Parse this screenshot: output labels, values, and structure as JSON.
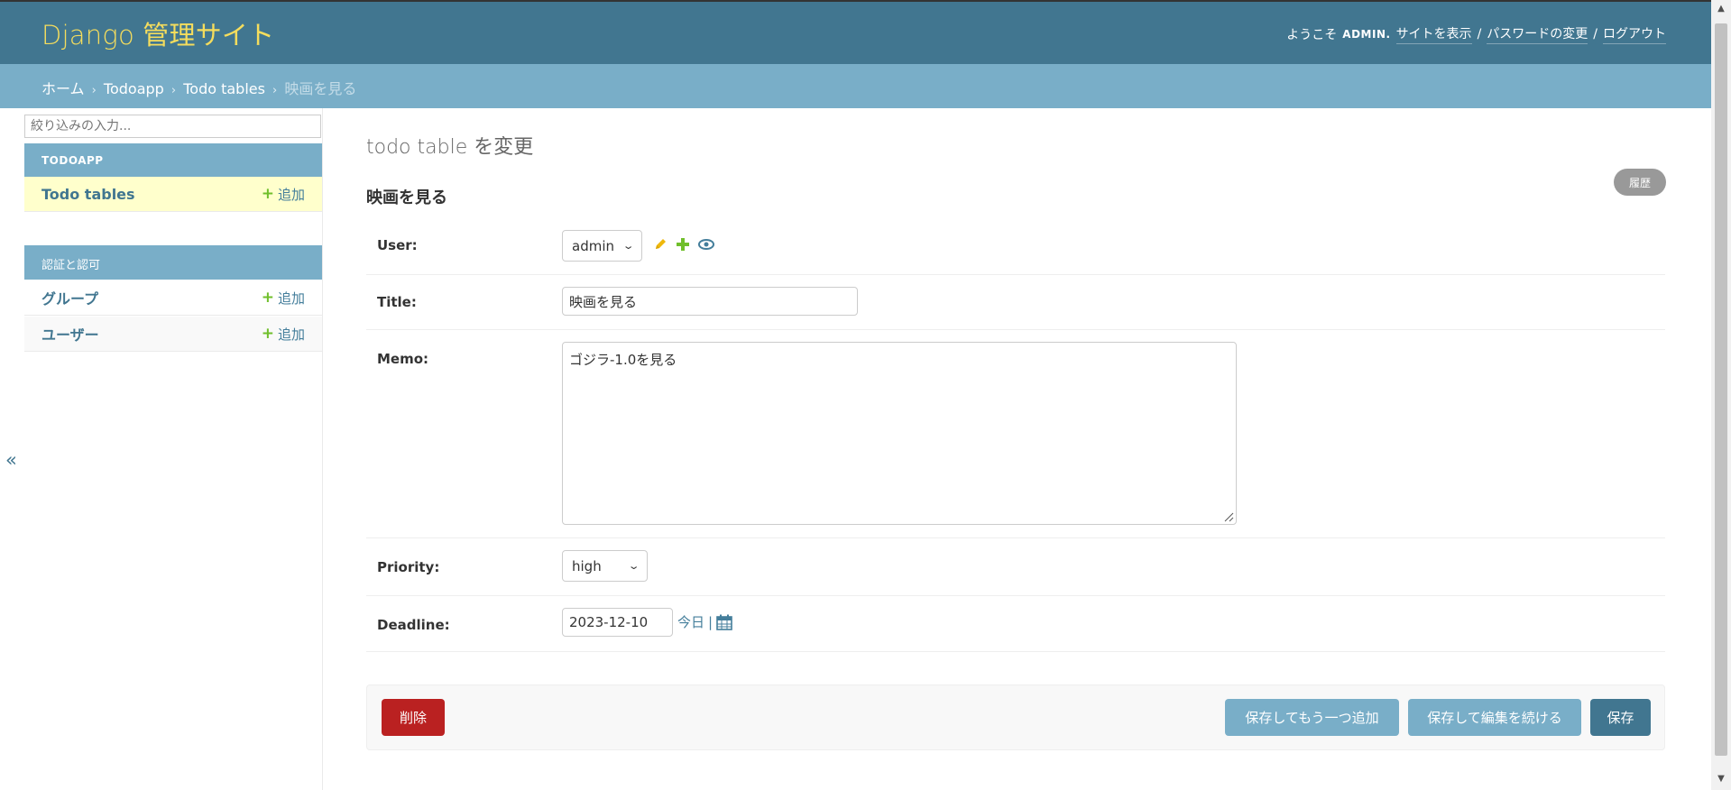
{
  "header": {
    "site_name": "Django 管理サイト",
    "welcome": "ようこそ",
    "username": "ADMIN",
    "welcome_suffix": ".",
    "view_site": "サイトを表示",
    "change_password": "パスワードの変更",
    "logout": "ログアウト",
    "separator": "/"
  },
  "breadcrumbs": {
    "items": [
      "ホーム",
      "Todoapp",
      "Todo tables",
      "映画を見る"
    ],
    "separator": "›"
  },
  "sidebar": {
    "filter_placeholder": "絞り込みの入力...",
    "modules": [
      {
        "caption": "TODOAPP",
        "models": [
          {
            "name": "Todo tables",
            "add": "追加"
          }
        ]
      },
      {
        "caption": "認証と認可",
        "models": [
          {
            "name": "グループ",
            "add": "追加"
          },
          {
            "name": "ユーザー",
            "add": "追加"
          }
        ]
      }
    ],
    "toggle": "«"
  },
  "content": {
    "title": "todo table を変更",
    "history": "履歴",
    "object_title": "映画を見る",
    "fields": {
      "user": {
        "label": "User:",
        "value": "admin"
      },
      "title": {
        "label": "Title:",
        "value": "映画を見る"
      },
      "memo": {
        "label": "Memo:",
        "value": "ゴジラ-1.0を見る"
      },
      "priority": {
        "label": "Priority:",
        "value": "high"
      },
      "deadline": {
        "label": "Deadline:",
        "value": "2023-12-10",
        "today": "今日",
        "divider": "|"
      }
    }
  },
  "submit": {
    "delete": "削除",
    "save_add_another": "保存してもう一つ追加",
    "save_continue": "保存して編集を続ける",
    "save": "保存"
  },
  "colors": {
    "header_bg": "#417690",
    "site_name": "#f5dd5d",
    "breadcrumb_bg": "#79aec8",
    "delete": "#ba2121",
    "primary": "#417690",
    "secondary": "#79aec8",
    "add_icon": "#70bf2b"
  }
}
